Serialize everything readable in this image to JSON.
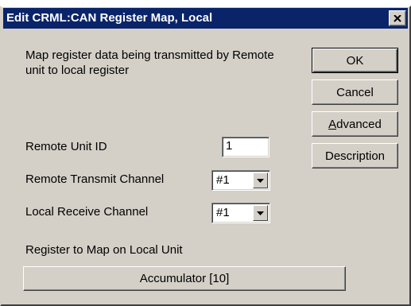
{
  "window": {
    "title": "Edit CRML:CAN Register Map, Local"
  },
  "description": "Map register data being transmitted by Remote unit to local register",
  "buttons": {
    "ok": "OK",
    "cancel": "Cancel",
    "advanced": "Advanced",
    "description": "Description",
    "register": "Accumulator [10]"
  },
  "fields": {
    "remote_unit_id": {
      "label": "Remote Unit ID",
      "value": "1"
    },
    "remote_transmit_channel": {
      "label": "Remote Transmit Channel",
      "value": "#1"
    },
    "local_receive_channel": {
      "label": "Local Receive Channel",
      "value": "#1"
    },
    "register_to_map": {
      "label": "Register to Map on Local Unit"
    }
  },
  "icons": {
    "close": "close-icon",
    "dropdown": "chevron-down-icon"
  },
  "colors": {
    "titlebar": "#0a246a",
    "dialog_face": "#d4d0c8"
  }
}
